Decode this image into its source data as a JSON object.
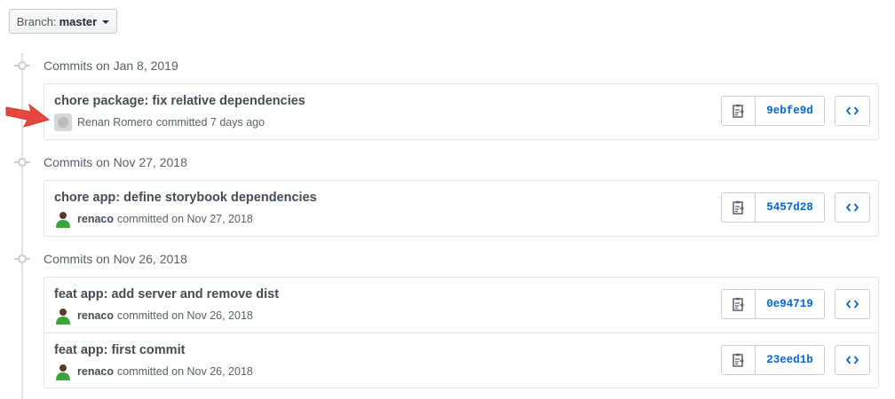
{
  "branch": {
    "label": "Branch:",
    "name": "master"
  },
  "groups": [
    {
      "title": "Commits on Jan 8, 2019",
      "commits": [
        {
          "message": "chore package: fix relative dependencies",
          "author": "Renan Romero",
          "action": "committed 7 days ago",
          "sha": "9ebfe9d",
          "avatar": "default-avatar-icon"
        }
      ]
    },
    {
      "title": "Commits on Nov 27, 2018",
      "commits": [
        {
          "message": "chore app: define storybook dependencies",
          "author": "renaco",
          "action": "committed on Nov 27, 2018",
          "sha": "5457d28",
          "avatar": "user-avatar"
        }
      ]
    },
    {
      "title": "Commits on Nov 26, 2018",
      "commits": [
        {
          "message": "feat app: add server and remove dist",
          "author": "renaco",
          "action": "committed on Nov 26, 2018",
          "sha": "0e94719",
          "avatar": "user-avatar"
        },
        {
          "message": "feat app: first commit",
          "author": "renaco",
          "action": "committed on Nov 26, 2018",
          "sha": "23eed1b",
          "avatar": "user-avatar"
        }
      ]
    }
  ],
  "icons": {
    "copy": "clipboard-icon",
    "browse": "code-icon",
    "pointer": "red-arrow-icon"
  },
  "colors": {
    "sha": "#0366d6",
    "arrow": "#e8473f",
    "avatar_green": "#3aa33a"
  }
}
